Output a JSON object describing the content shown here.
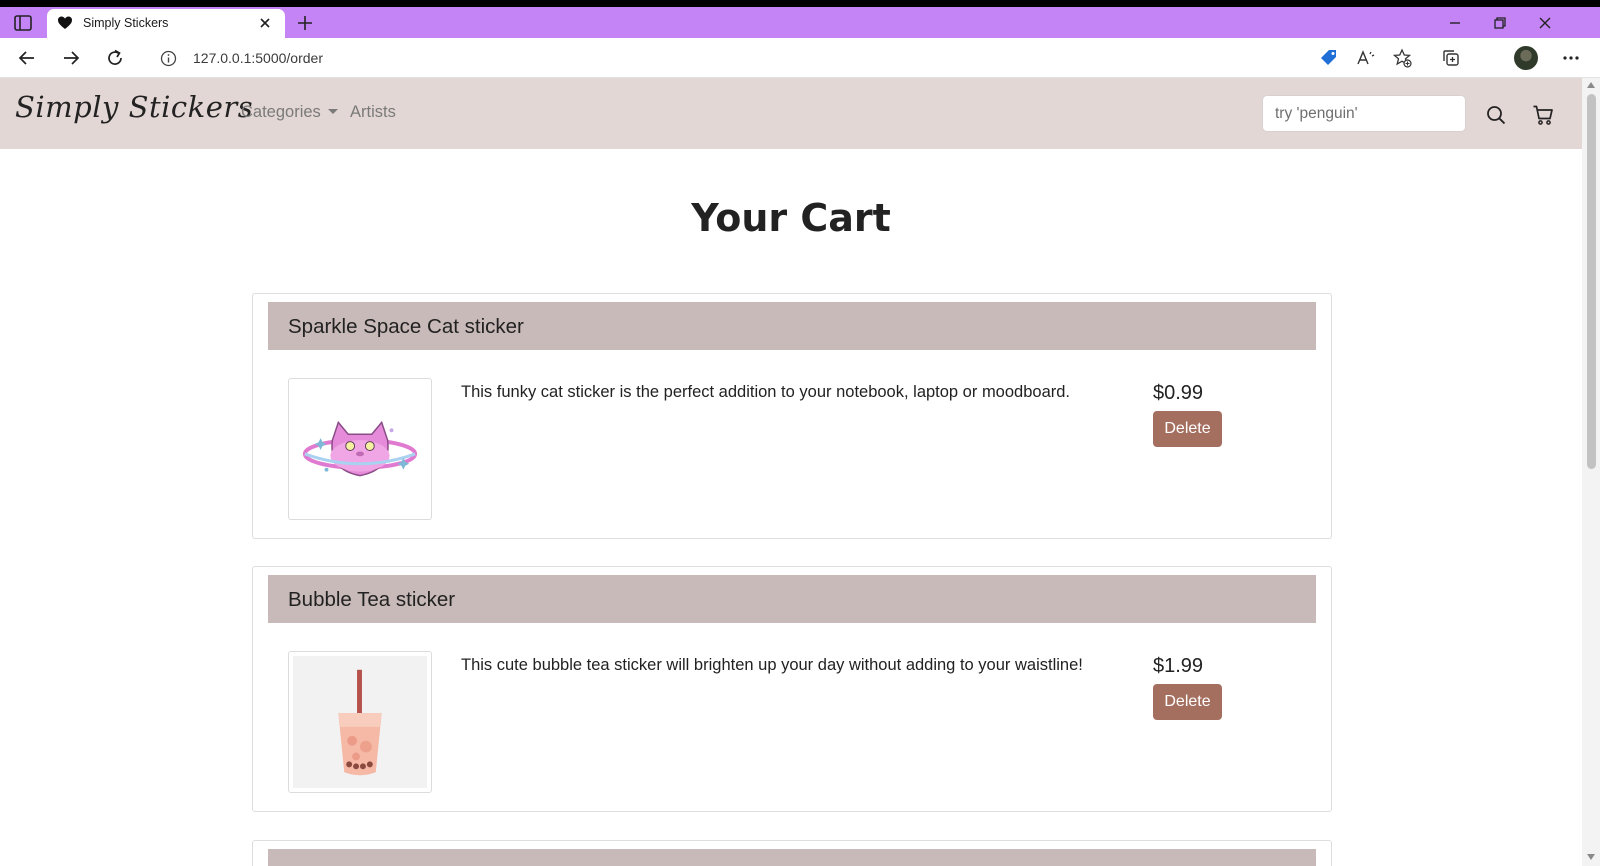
{
  "browser": {
    "tab_title": "Simply Stickers",
    "url": "127.0.0.1:5000/order",
    "icons": {
      "tab_actions": "tab-actions-icon",
      "favicon": "heart-icon",
      "close_tab": "close-icon",
      "new_tab": "plus-icon",
      "back": "back-arrow-icon",
      "forward": "forward-arrow-icon",
      "refresh": "refresh-icon",
      "site_info": "info-icon",
      "shopping": "price-tag-icon",
      "read_aloud": "read-aloud-icon",
      "favorites": "star-add-icon",
      "collections": "collections-icon",
      "profile": "avatar",
      "menu": "more-icon",
      "minimize": "minimize-icon",
      "maximize": "restore-icon",
      "close_window": "close-icon"
    },
    "accent_color": "#c584f6"
  },
  "navbar": {
    "brand": "Simply Stickers",
    "links": {
      "categories": "Categories",
      "artists": "Artists"
    },
    "search_placeholder": "try 'penguin'",
    "icons": {
      "search": "search-icon",
      "cart": "cart-icon"
    },
    "background": "#e3d7d5"
  },
  "page": {
    "title": "Your Cart"
  },
  "cart": {
    "items": [
      {
        "title": "Sparkle Space Cat sticker",
        "description": "This funky cat sticker is the perfect addition to your notebook, laptop or moodboard.",
        "price": "$0.99",
        "delete_label": "Delete",
        "image": "space-cat-sticker"
      },
      {
        "title": "Bubble Tea sticker",
        "description": "This cute bubble tea sticker will brighten up your day without adding to your waistline!",
        "price": "$1.99",
        "delete_label": "Delete",
        "image": "bubble-tea-sticker"
      }
    ],
    "header_color": "#c8bab8",
    "button_color": "#a56f60"
  }
}
